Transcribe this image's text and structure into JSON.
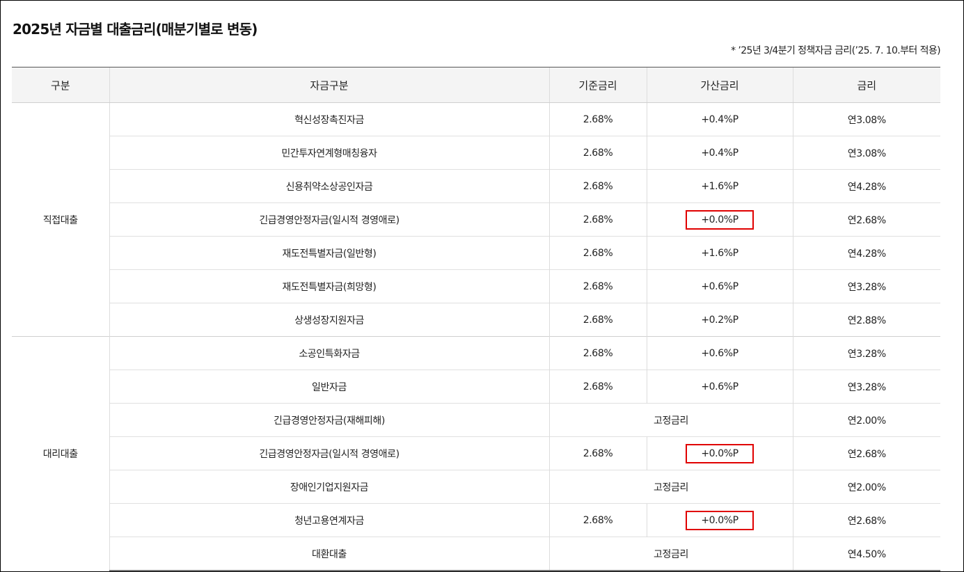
{
  "title": "2025년 자금별 대출금리(매분기별로 변동)",
  "note": "* ’25년 3/4분기 정책자금 금리(’25. 7. 10.부터 적용)",
  "headers": {
    "category": "구분",
    "fund": "자금구분",
    "base": "기준금리",
    "add": "가산금리",
    "rate": "금리"
  },
  "groups": {
    "direct": "직접대출",
    "agency": "대리대출"
  },
  "rows": [
    {
      "fund": "혁신성장촉진자금",
      "base": "2.68%",
      "add": "+0.4%P",
      "rate": "연3.08%"
    },
    {
      "fund": "민간투자연계형매칭융자",
      "base": "2.68%",
      "add": "+0.4%P",
      "rate": "연3.08%"
    },
    {
      "fund": "신용취약소상공인자금",
      "base": "2.68%",
      "add": "+1.6%P",
      "rate": "연4.28%"
    },
    {
      "fund": "긴급경영안정자금(일시적 경영애로)",
      "base": "2.68%",
      "add": "+0.0%P",
      "rate": "연2.68%"
    },
    {
      "fund": "재도전특별자금(일반형)",
      "base": "2.68%",
      "add": "+1.6%P",
      "rate": "연4.28%"
    },
    {
      "fund": "재도전특별자금(희망형)",
      "base": "2.68%",
      "add": "+0.6%P",
      "rate": "연3.28%"
    },
    {
      "fund": "상생성장지원자금",
      "base": "2.68%",
      "add": "+0.2%P",
      "rate": "연2.88%"
    },
    {
      "fund": "소공인특화자금",
      "base": "2.68%",
      "add": "+0.6%P",
      "rate": "연3.28%"
    },
    {
      "fund": "일반자금",
      "base": "2.68%",
      "add": "+0.6%P",
      "rate": "연3.28%"
    },
    {
      "fund": "긴급경영안정자금(재해피해)",
      "fixed": "고정금리",
      "rate": "연2.00%"
    },
    {
      "fund": "긴급경영안정자금(일시적 경영애로)",
      "base": "2.68%",
      "add": "+0.0%P",
      "rate": "연2.68%"
    },
    {
      "fund": "장애인기업지원자금",
      "fixed": "고정금리",
      "rate": "연2.00%"
    },
    {
      "fund": "청년고용연계자금",
      "base": "2.68%",
      "add": "+0.0%P",
      "rate": "연2.68%"
    },
    {
      "fund": "대환대출",
      "fixed": "고정금리",
      "rate": "연4.50%"
    }
  ],
  "highlight_color": "#e00000"
}
